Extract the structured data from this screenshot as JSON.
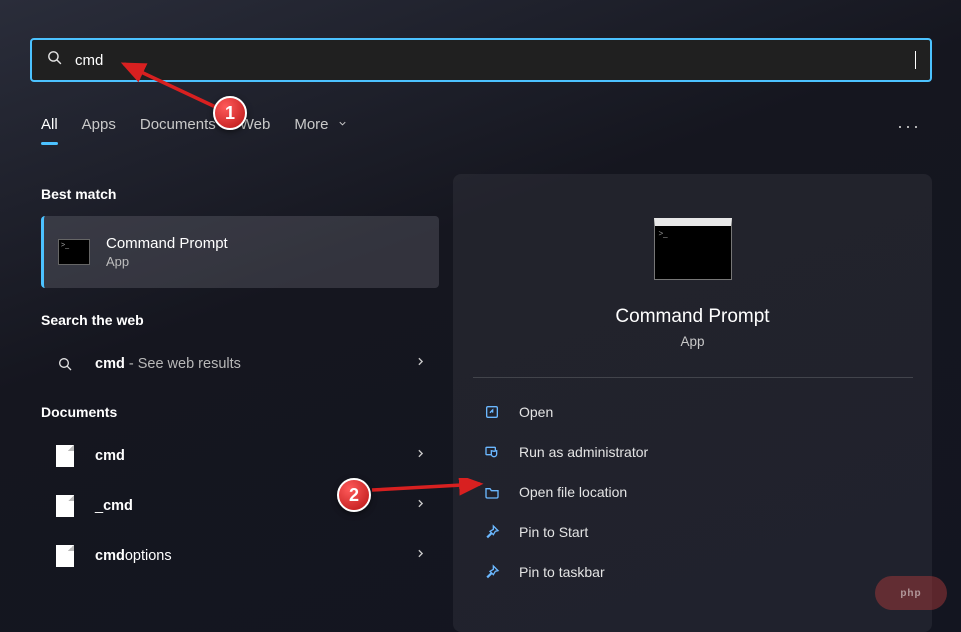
{
  "search": {
    "value": "cmd"
  },
  "tabs": {
    "all": "All",
    "apps": "Apps",
    "documents": "Documents",
    "web": "Web",
    "more": "More"
  },
  "sections": {
    "best_match": "Best match",
    "search_web": "Search the web",
    "documents": "Documents"
  },
  "best_match": {
    "title": "Command Prompt",
    "subtitle": "App"
  },
  "web_result": {
    "term": "cmd",
    "suffix": " - See web results"
  },
  "docs": [
    {
      "bold": "cmd",
      "rest": ""
    },
    {
      "bold": "",
      "rest": "_",
      "bold2": "cmd"
    },
    {
      "bold": "cmd",
      "rest": "options"
    }
  ],
  "preview": {
    "title": "Command Prompt",
    "subtitle": "App"
  },
  "actions": {
    "open": "Open",
    "run_admin": "Run as administrator",
    "open_location": "Open file location",
    "pin_start": "Pin to Start",
    "pin_taskbar": "Pin to taskbar"
  },
  "annotations": {
    "marker1": "1",
    "marker2": "2"
  },
  "watermark": "php"
}
